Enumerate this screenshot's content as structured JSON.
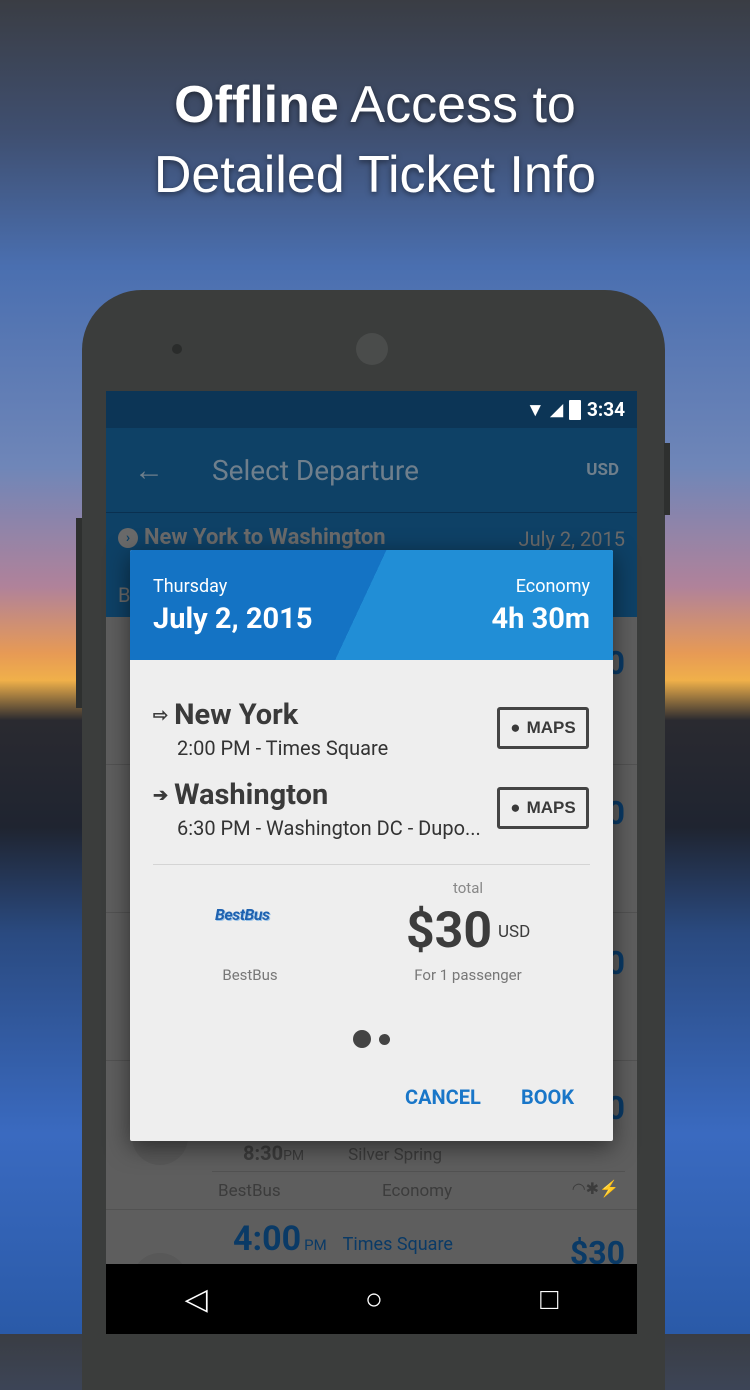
{
  "headline": {
    "bold": "Offline",
    "rest1": " Access to",
    "line2": "Detailed Ticket Info"
  },
  "status": {
    "time": "3:34",
    "icons": [
      "wifi-icon",
      "signal-icon",
      "battery-charging-icon"
    ]
  },
  "appbar": {
    "back_icon": "arrow-left-icon",
    "title": "Select Departure",
    "currency": "USD"
  },
  "subheader": {
    "route": "New York to Washington",
    "date": "July 2, 2015",
    "tab_partial": "B"
  },
  "list": {
    "rows": [
      {
        "price_partial": "0"
      },
      {
        "price_partial": "0"
      },
      {
        "price_partial": "0"
      },
      {
        "price_partial": "0"
      }
    ],
    "visible_row": {
      "arrive_time": "8:30",
      "arrive_ampm": "PM",
      "arrive_stop": "Silver Spring",
      "operator": "BestBus",
      "class": "Economy",
      "amenities": [
        "wifi-icon",
        "snowflake-icon",
        "plug-icon"
      ]
    },
    "next_row": {
      "time": "4:00",
      "ampm": "PM",
      "stop": "Times Square",
      "price": "$30"
    }
  },
  "dialog": {
    "day": "Thursday",
    "date": "July 2, 2015",
    "class": "Economy",
    "duration": "4h 30m",
    "origin": {
      "city": "New York",
      "detail": "2:00 PM - Times Square",
      "maps": "MAPS"
    },
    "destination": {
      "city": "Washington",
      "detail": "6:30 PM - Washington DC - Dupo...",
      "maps": "MAPS"
    },
    "operator_logo": "BestBus",
    "operator": "BestBus",
    "total_label": "total",
    "amount": "$30",
    "currency": "USD",
    "passengers": "For 1 passenger",
    "page_indicator": {
      "pages": 2,
      "current": 1
    },
    "cancel": "CANCEL",
    "book": "BOOK",
    "header_color": "#1E88D0",
    "accent": "#1976C8"
  },
  "navbar": {
    "icons": [
      "back-triangle-icon",
      "home-circle-icon",
      "recents-square-icon"
    ]
  }
}
